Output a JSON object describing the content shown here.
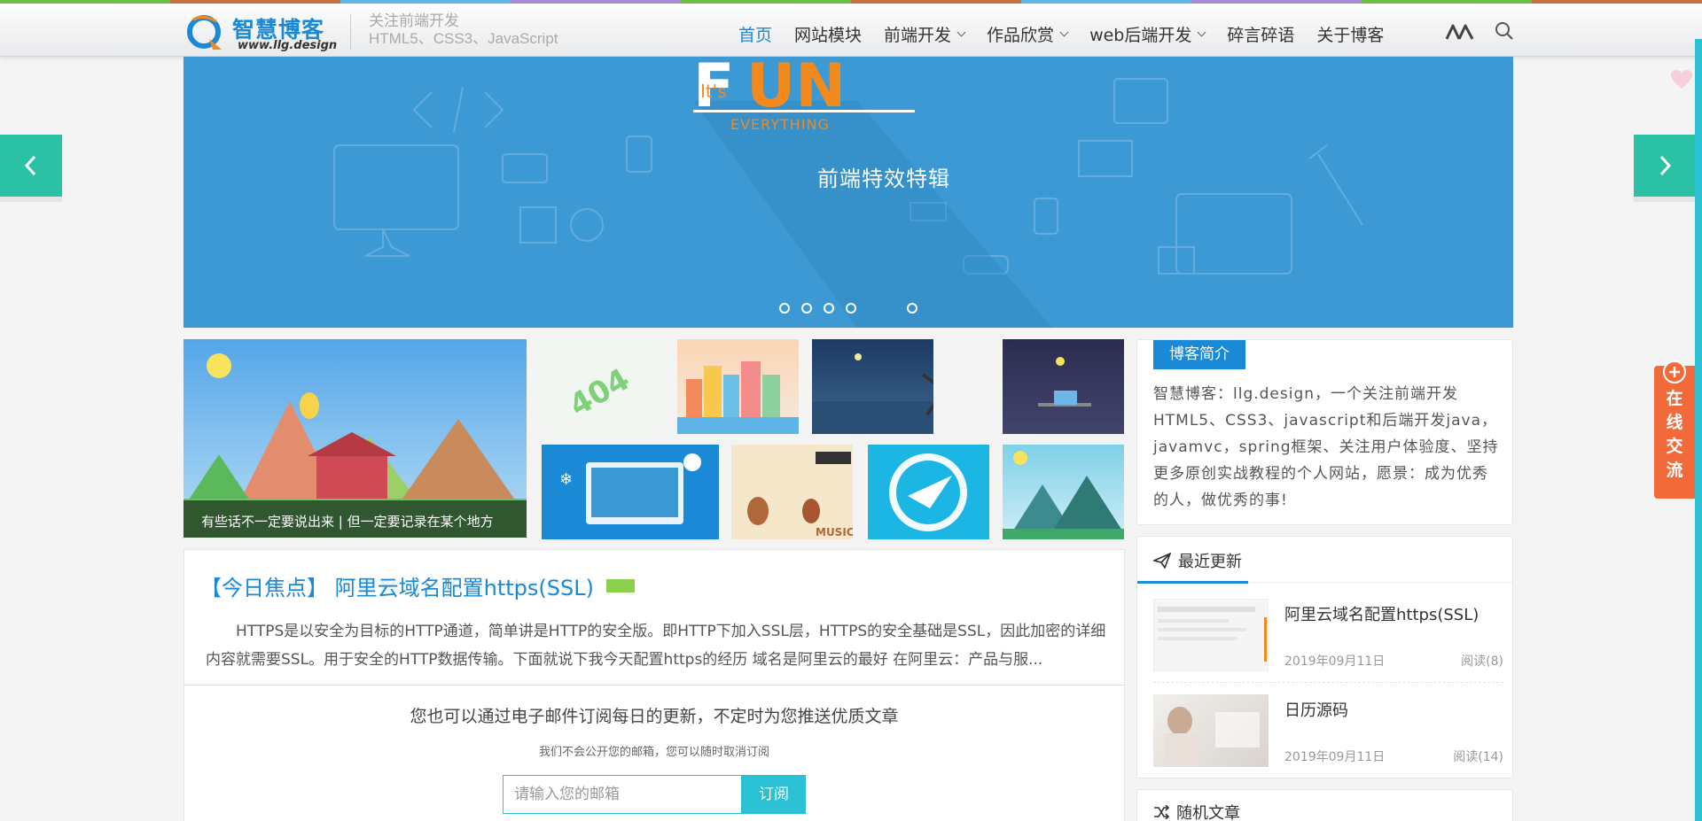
{
  "header": {
    "logo_title": "智慧博客",
    "logo_url": "www.llg.design",
    "tagline_line1": "关注前端开发",
    "tagline_line2": "HTML5、CSS3、JavaScript",
    "nav": [
      {
        "label": "首页",
        "active": true,
        "dropdown": false
      },
      {
        "label": "网站模块",
        "active": false,
        "dropdown": false
      },
      {
        "label": "前端开发",
        "active": false,
        "dropdown": true
      },
      {
        "label": "作品欣赏",
        "active": false,
        "dropdown": true
      },
      {
        "label": "web后端开发",
        "active": false,
        "dropdown": true
      },
      {
        "label": "碎言碎语",
        "active": false,
        "dropdown": false
      },
      {
        "label": "关于博客",
        "active": false,
        "dropdown": false
      }
    ],
    "icons": [
      "m-logo-icon",
      "search-icon"
    ]
  },
  "banner": {
    "logo_small": "It's",
    "logo_big": "FUN",
    "logo_sub": "EVERYTHING",
    "caption": "前端特效特辑",
    "slide_dots": 5,
    "bg_color": "#3d99d3"
  },
  "featured": {
    "caption": "有些话不一定要说出来 | 但一定要记录在某个地方"
  },
  "focus": {
    "label": "【今日焦点】",
    "title": "阿里云域名配置https(SSL)",
    "excerpt": "HTTPS是以安全为目标的HTTP通道，简单讲是HTTP的安全版。即HTTP下加入SSL层，HTTPS的安全基础是SSL，因此加密的详细内容就需要SSL。用于安全的HTTP数据传输。下面就说下我今天配置https的经历 域名是阿里云的最好 在阿里云：产品与服..."
  },
  "subscribe": {
    "title": "您也可以通过电子邮件订阅每日的更新，不定时为您推送优质文章",
    "note": "我们不会公开您的邮箱，您可以随时取消订阅",
    "placeholder": "请输入您的邮箱",
    "button": "订阅"
  },
  "sidebar": {
    "intro_title": "博客简介",
    "intro_text": "智慧博客：llg.design，一个关注前端开发HTML5、CSS3、javascript和后端开发java，javamvc，spring框架、关注用户体验度、坚持更多原创实战教程的个人网站，愿景：成为优秀的人，做优秀的事!",
    "recent_title": "最近更新",
    "recent_posts": [
      {
        "title": "阿里云域名配置https(SSL)",
        "date": "2019年09月11日",
        "views": "阅读(8)"
      },
      {
        "title": "日历源码",
        "date": "2019年09月11日",
        "views": "阅读(14)"
      }
    ],
    "random_title": "随机文章"
  },
  "float_chat": {
    "label": "在线交流"
  },
  "colors": {
    "accent": "#1b8ad6",
    "teal": "#2bc1a5",
    "subscribe": "#2bc1d4",
    "chat": "#f2693a"
  }
}
